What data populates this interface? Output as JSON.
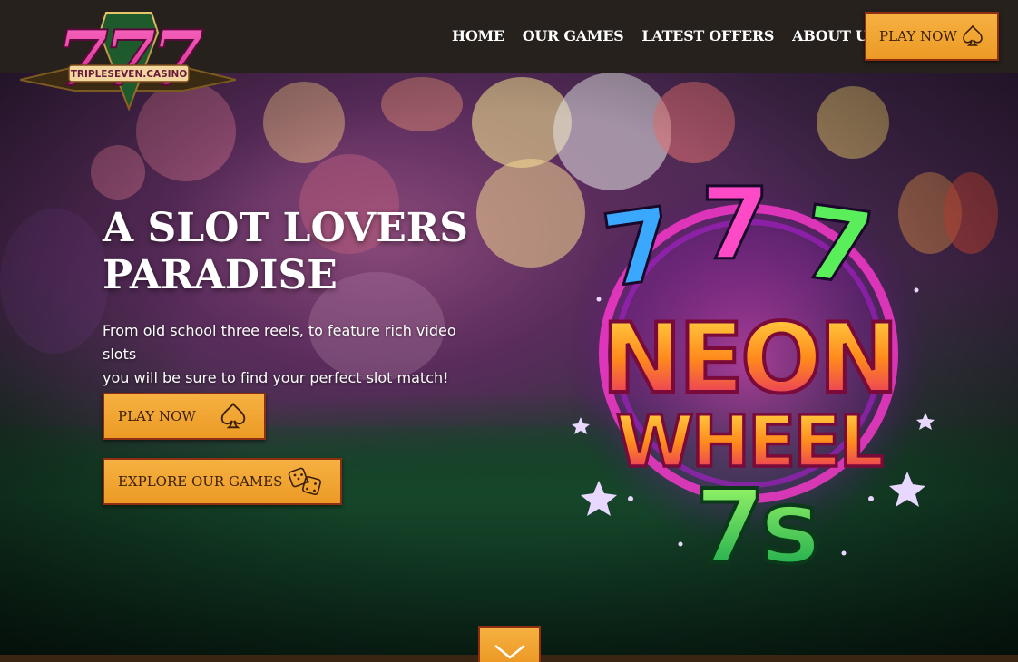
{
  "brand": {
    "logo_text": "TRIPLESEVEN.CASINO",
    "digits": "777"
  },
  "nav": {
    "items": [
      "HOME",
      "OUR GAMES",
      "LATEST OFFERS",
      "ABOUT US"
    ],
    "cta_label": "PLAY NOW",
    "cta_icon": "spade-icon"
  },
  "hero": {
    "title_line1": "A SLOT LOVERS",
    "title_line2": "PARADISE",
    "subtitle_line1": "From old school three reels, to feature rich video slots",
    "subtitle_line2": "you will be sure to find your perfect slot match!",
    "play_label": "PLAY NOW",
    "play_icon": "spade-icon",
    "explore_label": "EXPLORE OUR GAMES",
    "explore_icon": "dice-icon"
  },
  "game": {
    "sevens": "777",
    "line1": "NEON",
    "line2": "WHEEL",
    "line3": "7s"
  },
  "scroll": {
    "icon": "chevron-down-icon"
  },
  "colors": {
    "header_bg": "#27211d",
    "button_orange": "#f0a12e",
    "button_border": "#8e2f12",
    "button_text": "#3b2007",
    "text_white": "#ffffff"
  }
}
